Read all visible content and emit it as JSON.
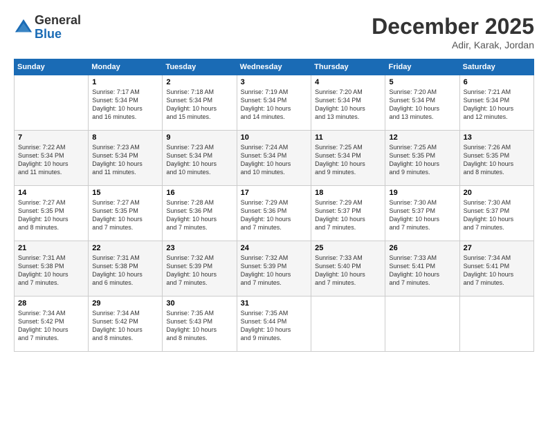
{
  "logo": {
    "general": "General",
    "blue": "Blue"
  },
  "title": "December 2025",
  "location": "Adir, Karak, Jordan",
  "days_header": [
    "Sunday",
    "Monday",
    "Tuesday",
    "Wednesday",
    "Thursday",
    "Friday",
    "Saturday"
  ],
  "weeks": [
    [
      {
        "day": "",
        "info": ""
      },
      {
        "day": "1",
        "info": "Sunrise: 7:17 AM\nSunset: 5:34 PM\nDaylight: 10 hours\nand 16 minutes."
      },
      {
        "day": "2",
        "info": "Sunrise: 7:18 AM\nSunset: 5:34 PM\nDaylight: 10 hours\nand 15 minutes."
      },
      {
        "day": "3",
        "info": "Sunrise: 7:19 AM\nSunset: 5:34 PM\nDaylight: 10 hours\nand 14 minutes."
      },
      {
        "day": "4",
        "info": "Sunrise: 7:20 AM\nSunset: 5:34 PM\nDaylight: 10 hours\nand 13 minutes."
      },
      {
        "day": "5",
        "info": "Sunrise: 7:20 AM\nSunset: 5:34 PM\nDaylight: 10 hours\nand 13 minutes."
      },
      {
        "day": "6",
        "info": "Sunrise: 7:21 AM\nSunset: 5:34 PM\nDaylight: 10 hours\nand 12 minutes."
      }
    ],
    [
      {
        "day": "7",
        "info": "Sunrise: 7:22 AM\nSunset: 5:34 PM\nDaylight: 10 hours\nand 11 minutes."
      },
      {
        "day": "8",
        "info": "Sunrise: 7:23 AM\nSunset: 5:34 PM\nDaylight: 10 hours\nand 11 minutes."
      },
      {
        "day": "9",
        "info": "Sunrise: 7:23 AM\nSunset: 5:34 PM\nDaylight: 10 hours\nand 10 minutes."
      },
      {
        "day": "10",
        "info": "Sunrise: 7:24 AM\nSunset: 5:34 PM\nDaylight: 10 hours\nand 10 minutes."
      },
      {
        "day": "11",
        "info": "Sunrise: 7:25 AM\nSunset: 5:34 PM\nDaylight: 10 hours\nand 9 minutes."
      },
      {
        "day": "12",
        "info": "Sunrise: 7:25 AM\nSunset: 5:35 PM\nDaylight: 10 hours\nand 9 minutes."
      },
      {
        "day": "13",
        "info": "Sunrise: 7:26 AM\nSunset: 5:35 PM\nDaylight: 10 hours\nand 8 minutes."
      }
    ],
    [
      {
        "day": "14",
        "info": "Sunrise: 7:27 AM\nSunset: 5:35 PM\nDaylight: 10 hours\nand 8 minutes."
      },
      {
        "day": "15",
        "info": "Sunrise: 7:27 AM\nSunset: 5:35 PM\nDaylight: 10 hours\nand 7 minutes."
      },
      {
        "day": "16",
        "info": "Sunrise: 7:28 AM\nSunset: 5:36 PM\nDaylight: 10 hours\nand 7 minutes."
      },
      {
        "day": "17",
        "info": "Sunrise: 7:29 AM\nSunset: 5:36 PM\nDaylight: 10 hours\nand 7 minutes."
      },
      {
        "day": "18",
        "info": "Sunrise: 7:29 AM\nSunset: 5:37 PM\nDaylight: 10 hours\nand 7 minutes."
      },
      {
        "day": "19",
        "info": "Sunrise: 7:30 AM\nSunset: 5:37 PM\nDaylight: 10 hours\nand 7 minutes."
      },
      {
        "day": "20",
        "info": "Sunrise: 7:30 AM\nSunset: 5:37 PM\nDaylight: 10 hours\nand 7 minutes."
      }
    ],
    [
      {
        "day": "21",
        "info": "Sunrise: 7:31 AM\nSunset: 5:38 PM\nDaylight: 10 hours\nand 7 minutes."
      },
      {
        "day": "22",
        "info": "Sunrise: 7:31 AM\nSunset: 5:38 PM\nDaylight: 10 hours\nand 6 minutes."
      },
      {
        "day": "23",
        "info": "Sunrise: 7:32 AM\nSunset: 5:39 PM\nDaylight: 10 hours\nand 7 minutes."
      },
      {
        "day": "24",
        "info": "Sunrise: 7:32 AM\nSunset: 5:39 PM\nDaylight: 10 hours\nand 7 minutes."
      },
      {
        "day": "25",
        "info": "Sunrise: 7:33 AM\nSunset: 5:40 PM\nDaylight: 10 hours\nand 7 minutes."
      },
      {
        "day": "26",
        "info": "Sunrise: 7:33 AM\nSunset: 5:41 PM\nDaylight: 10 hours\nand 7 minutes."
      },
      {
        "day": "27",
        "info": "Sunrise: 7:34 AM\nSunset: 5:41 PM\nDaylight: 10 hours\nand 7 minutes."
      }
    ],
    [
      {
        "day": "28",
        "info": "Sunrise: 7:34 AM\nSunset: 5:42 PM\nDaylight: 10 hours\nand 7 minutes."
      },
      {
        "day": "29",
        "info": "Sunrise: 7:34 AM\nSunset: 5:42 PM\nDaylight: 10 hours\nand 8 minutes."
      },
      {
        "day": "30",
        "info": "Sunrise: 7:35 AM\nSunset: 5:43 PM\nDaylight: 10 hours\nand 8 minutes."
      },
      {
        "day": "31",
        "info": "Sunrise: 7:35 AM\nSunset: 5:44 PM\nDaylight: 10 hours\nand 9 minutes."
      },
      {
        "day": "",
        "info": ""
      },
      {
        "day": "",
        "info": ""
      },
      {
        "day": "",
        "info": ""
      }
    ]
  ]
}
